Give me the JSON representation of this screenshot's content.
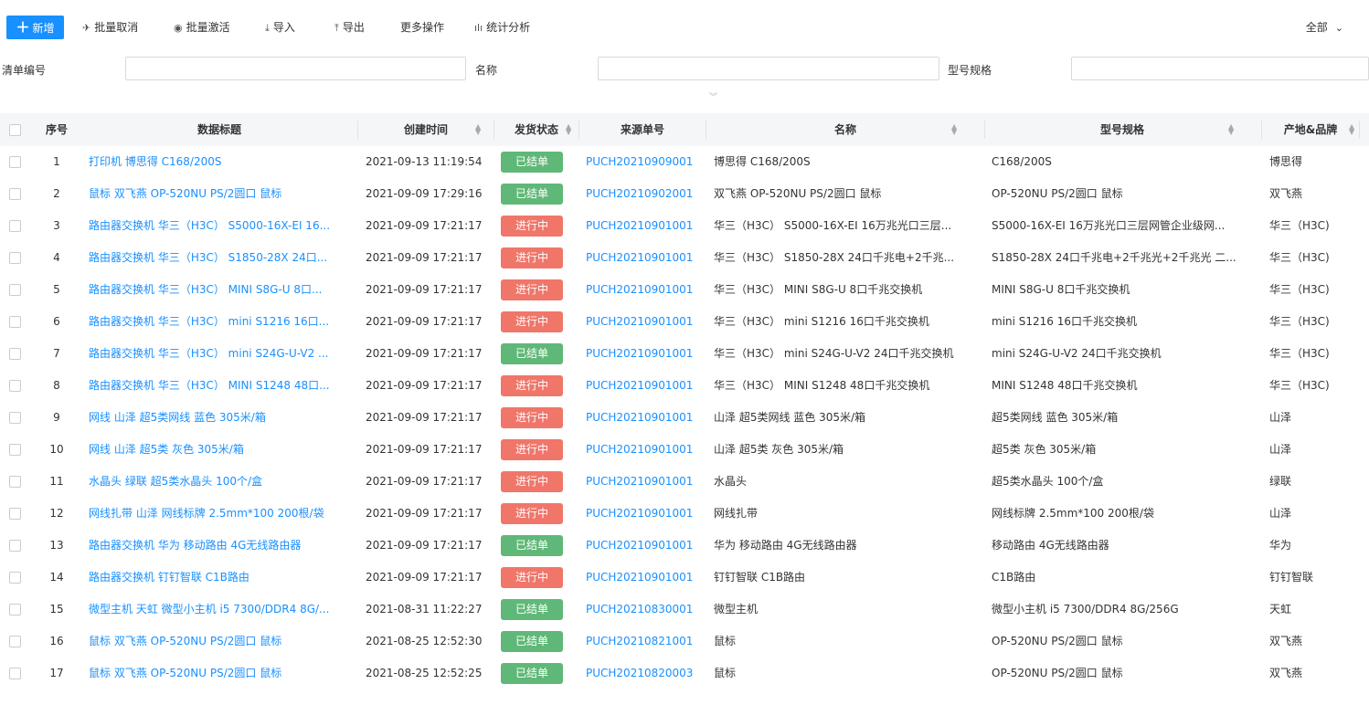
{
  "toolbar": {
    "add_label": "新增",
    "batch_cancel_label": "批量取消",
    "batch_activate_label": "批量激活",
    "import_label": "导入",
    "export_label": "导出",
    "more_label": "更多操作",
    "stats_label": "统计分析",
    "scope_label": "全部"
  },
  "filters": {
    "order_no_label": "清单编号",
    "order_no_value": "",
    "name_label": "名称",
    "name_value": "",
    "model_label": "型号规格",
    "model_value": ""
  },
  "table": {
    "headers": {
      "idx": "序号",
      "title": "数据标题",
      "created": "创建时间",
      "status": "发货状态",
      "source": "来源单号",
      "name": "名称",
      "model": "型号规格",
      "brand": "产地&品牌"
    },
    "status_colors": {
      "已结单": "#5fb878",
      "进行中": "#f0766a"
    },
    "rows": [
      {
        "idx": "1",
        "title": "打印机 博思得 C168/200S",
        "created": "2021-09-13 11:19:54",
        "status": "已结单",
        "source": "PUCH20210909001",
        "name": "博思得 C168/200S",
        "model": "C168/200S",
        "brand": "博思得"
      },
      {
        "idx": "2",
        "title": "鼠标 双飞燕 OP-520NU PS/2圆口 鼠标",
        "created": "2021-09-09 17:29:16",
        "status": "已结单",
        "source": "PUCH20210902001",
        "name": "双飞燕 OP-520NU PS/2圆口 鼠标",
        "model": "OP-520NU PS/2圆口 鼠标",
        "brand": "双飞燕"
      },
      {
        "idx": "3",
        "title": "路由器交换机 华三（H3C） S5000-16X-EI 16...",
        "created": "2021-09-09 17:21:17",
        "status": "进行中",
        "source": "PUCH20210901001",
        "name": "华三（H3C） S5000-16X-EI 16万兆光口三层...",
        "model": "S5000-16X-EI 16万兆光口三层网管企业级网...",
        "brand": "华三（H3C)"
      },
      {
        "idx": "4",
        "title": "路由器交换机 华三（H3C） S1850-28X 24口...",
        "created": "2021-09-09 17:21:17",
        "status": "进行中",
        "source": "PUCH20210901001",
        "name": "华三（H3C） S1850-28X 24口千兆电+2千兆...",
        "model": "S1850-28X 24口千兆电+2千兆光+2千兆光 二...",
        "brand": "华三（H3C)"
      },
      {
        "idx": "5",
        "title": "路由器交换机 华三（H3C） MINI S8G-U 8口...",
        "created": "2021-09-09 17:21:17",
        "status": "进行中",
        "source": "PUCH20210901001",
        "name": "华三（H3C） MINI S8G-U 8口千兆交换机",
        "model": "MINI S8G-U 8口千兆交换机",
        "brand": "华三（H3C)"
      },
      {
        "idx": "6",
        "title": "路由器交换机 华三（H3C） mini S1216 16口...",
        "created": "2021-09-09 17:21:17",
        "status": "进行中",
        "source": "PUCH20210901001",
        "name": "华三（H3C） mini S1216 16口千兆交换机",
        "model": "mini S1216 16口千兆交换机",
        "brand": "华三（H3C)"
      },
      {
        "idx": "7",
        "title": "路由器交换机 华三（H3C） mini S24G-U-V2 ...",
        "created": "2021-09-09 17:21:17",
        "status": "已结单",
        "source": "PUCH20210901001",
        "name": "华三（H3C） mini S24G-U-V2 24口千兆交换机",
        "model": "mini S24G-U-V2 24口千兆交换机",
        "brand": "华三（H3C)"
      },
      {
        "idx": "8",
        "title": "路由器交换机 华三（H3C） MINI S1248 48口...",
        "created": "2021-09-09 17:21:17",
        "status": "进行中",
        "source": "PUCH20210901001",
        "name": "华三（H3C） MINI S1248 48口千兆交换机",
        "model": "MINI S1248 48口千兆交换机",
        "brand": "华三（H3C)"
      },
      {
        "idx": "9",
        "title": "网线 山泽 超5类网线 蓝色 305米/箱",
        "created": "2021-09-09 17:21:17",
        "status": "进行中",
        "source": "PUCH20210901001",
        "name": "山泽 超5类网线 蓝色 305米/箱",
        "model": "超5类网线 蓝色 305米/箱",
        "brand": "山泽"
      },
      {
        "idx": "10",
        "title": "网线 山泽 超5类 灰色 305米/箱",
        "created": "2021-09-09 17:21:17",
        "status": "进行中",
        "source": "PUCH20210901001",
        "name": "山泽 超5类 灰色 305米/箱",
        "model": "超5类 灰色 305米/箱",
        "brand": "山泽"
      },
      {
        "idx": "11",
        "title": "水晶头 绿联 超5类水晶头 100个/盒",
        "created": "2021-09-09 17:21:17",
        "status": "进行中",
        "source": "PUCH20210901001",
        "name": "水晶头",
        "model": "超5类水晶头 100个/盒",
        "brand": "绿联"
      },
      {
        "idx": "12",
        "title": "网线扎带 山泽 网线标牌 2.5mm*100 200根/袋",
        "created": "2021-09-09 17:21:17",
        "status": "进行中",
        "source": "PUCH20210901001",
        "name": "网线扎带",
        "model": "网线标牌 2.5mm*100 200根/袋",
        "brand": "山泽"
      },
      {
        "idx": "13",
        "title": "路由器交换机 华为 移动路由 4G无线路由器",
        "created": "2021-09-09 17:21:17",
        "status": "已结单",
        "source": "PUCH20210901001",
        "name": "华为 移动路由 4G无线路由器",
        "model": "移动路由 4G无线路由器",
        "brand": "华为"
      },
      {
        "idx": "14",
        "title": "路由器交换机 钉钉智联 C1B路由",
        "created": "2021-09-09 17:21:17",
        "status": "进行中",
        "source": "PUCH20210901001",
        "name": "钉钉智联 C1B路由",
        "model": "C1B路由",
        "brand": "钉钉智联"
      },
      {
        "idx": "15",
        "title": "微型主机 天虹 微型小主机 i5 7300/DDR4 8G/...",
        "created": "2021-08-31 11:22:27",
        "status": "已结单",
        "source": "PUCH20210830001",
        "name": "微型主机",
        "model": "微型小主机 i5 7300/DDR4 8G/256G",
        "brand": "天虹"
      },
      {
        "idx": "16",
        "title": "鼠标 双飞燕 OP-520NU PS/2圆口 鼠标",
        "created": "2021-08-25 12:52:30",
        "status": "已结单",
        "source": "PUCH20210821001",
        "name": "鼠标",
        "model": "OP-520NU PS/2圆口 鼠标",
        "brand": "双飞燕"
      },
      {
        "idx": "17",
        "title": "鼠标 双飞燕 OP-520NU PS/2圆口 鼠标",
        "created": "2021-08-25 12:52:25",
        "status": "已结单",
        "source": "PUCH20210820003",
        "name": "鼠标",
        "model": "OP-520NU PS/2圆口 鼠标",
        "brand": "双飞燕"
      }
    ]
  }
}
